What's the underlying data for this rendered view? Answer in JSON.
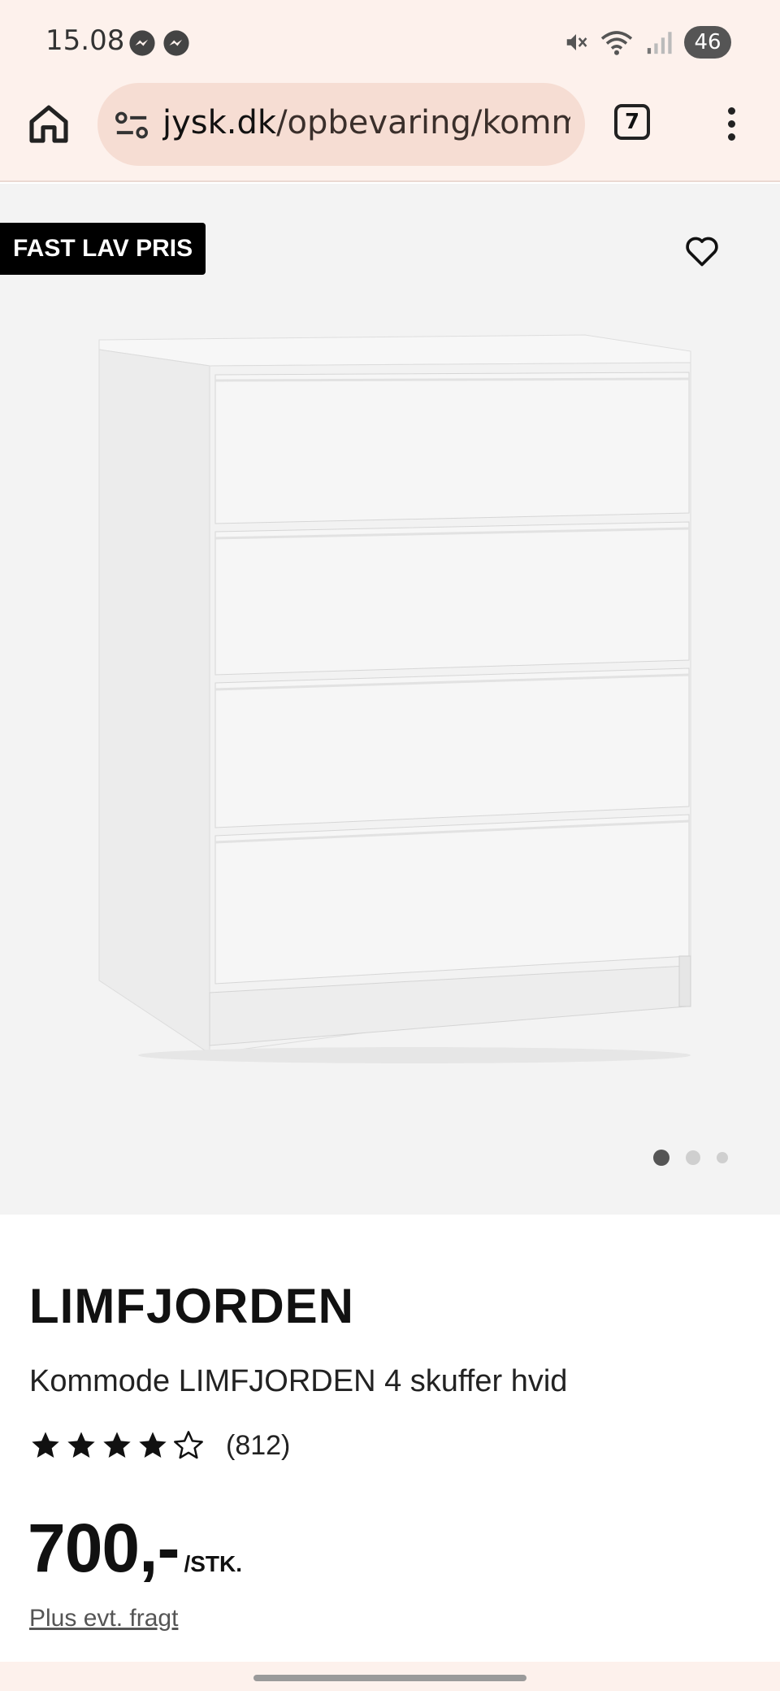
{
  "status_bar": {
    "time": "15.08",
    "battery": "46"
  },
  "browser": {
    "url_host": "jysk.dk",
    "url_path": "/opbevaring/kommoder",
    "tab_count": "7"
  },
  "gallery": {
    "badge": "FAST LAV PRIS",
    "active_dot_index": 0,
    "dot_count": 3
  },
  "product": {
    "brand": "LIMFJORDEN",
    "name": "Kommode LIMFJORDEN 4 skuffer hvid",
    "rating_stars": 4,
    "rating_max": 5,
    "review_count": "(812)",
    "price": "700,-",
    "unit": "/STK.",
    "shipping_link": "Plus evt. fragt"
  },
  "colors": {
    "browser_bg": "#fdf1ec",
    "url_pill": "#f6ddd3",
    "gallery_bg": "#f3f3f3",
    "badge_bg": "#000000"
  },
  "icons": {
    "home": "home-icon",
    "site_settings": "tune-icon",
    "favorite": "heart-outline-icon",
    "menu": "more-vert-icon",
    "star_filled": "star-filled-icon",
    "star_empty": "star-outline-icon"
  }
}
